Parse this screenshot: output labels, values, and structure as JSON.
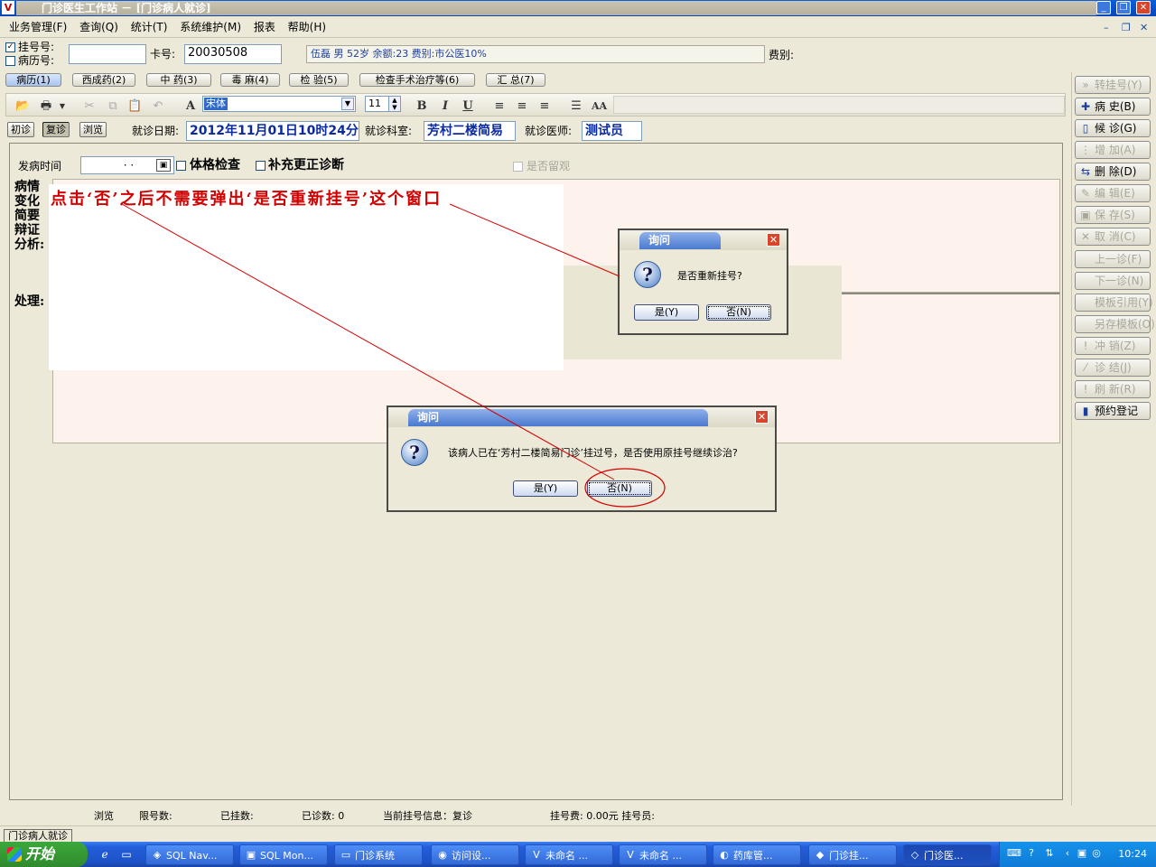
{
  "window": {
    "title": "门诊医生工作站 － [门诊病人就诊]",
    "app_icon": "V"
  },
  "menu": [
    "业务管理(F)",
    "查询(Q)",
    "统计(T)",
    "系统维护(M)",
    "报表",
    "帮助(H)"
  ],
  "header": {
    "reg_no_label": "挂号号:",
    "record_no_label": "病历号:",
    "reg_no_checked": true,
    "record_no_checked": false,
    "reg_no_value": "",
    "card_label": "卡号:",
    "card_value": "20030508",
    "patient_info": "伍磊  男  52岁  余额:23  费别:市公医10%",
    "fee_label": "费别:"
  },
  "tabs": [
    {
      "label": "病历(1)",
      "selected": true
    },
    {
      "label": "西成药(2)",
      "selected": false
    },
    {
      "label": "中 药(3)",
      "selected": false
    },
    {
      "label": "毒 麻(4)",
      "selected": false
    },
    {
      "label": "检 验(5)",
      "selected": false
    },
    {
      "label": "检查手术治疗等(6)",
      "selected": false
    },
    {
      "label": "汇 总(7)",
      "selected": false
    }
  ],
  "toolbar": {
    "font_name": "宋体",
    "font_size": "11",
    "bold": "B",
    "italic": "I",
    "underline": "U",
    "font_glyph": "A",
    "fontsize_glyph": "AA"
  },
  "visit": {
    "first_visit": "初诊",
    "return_visit": "复诊",
    "browse": "浏览",
    "date_label": "就诊日期:",
    "date_value": "2012年11月01日10时24分",
    "dept_label": "就诊科室:",
    "dept_value": "芳村二楼简易",
    "doctor_label": "就诊医师:",
    "doctor_value": "测试员"
  },
  "form": {
    "onset_label": "发病时间",
    "onset_value": "  ·  ·  ",
    "physical_exam": "体格检查",
    "supplement_diag": "补充更正诊断",
    "observation": "是否留观",
    "section_1": [
      "病情",
      "变化",
      "简要",
      "辩证",
      "分析:"
    ],
    "section_2": "处理:"
  },
  "annotation": "点击‘否’之后不需要弹出‘是否重新挂号’这个窗口",
  "right_buttons": [
    {
      "label": "转挂号(Y)",
      "enabled": false,
      "icon": "double-arrow-icon",
      "glyph": "»"
    },
    {
      "label": "病  史(B)",
      "enabled": true,
      "icon": "plus-icon",
      "glyph": "✚"
    },
    {
      "label": "候  诊(G)",
      "enabled": true,
      "icon": "document-icon",
      "glyph": "▯"
    },
    {
      "label": "增  加(A)",
      "enabled": false,
      "icon": "add-icon",
      "glyph": "⋮"
    },
    {
      "label": "删  除(D)",
      "enabled": true,
      "icon": "delete-icon",
      "glyph": "⇆"
    },
    {
      "label": "编  辑(E)",
      "enabled": false,
      "icon": "edit-icon",
      "glyph": "✎"
    },
    {
      "label": "保  存(S)",
      "enabled": false,
      "icon": "save-icon",
      "glyph": "▣"
    },
    {
      "label": "取  消(C)",
      "enabled": false,
      "icon": "cancel-icon",
      "glyph": "✕"
    },
    {
      "label": "上一诊(F)",
      "enabled": false,
      "icon": "",
      "glyph": ""
    },
    {
      "label": "下一诊(N)",
      "enabled": false,
      "icon": "",
      "glyph": ""
    },
    {
      "label": "模板引用(Y)",
      "enabled": false,
      "icon": "",
      "glyph": ""
    },
    {
      "label": "另存模板(O)",
      "enabled": false,
      "icon": "",
      "glyph": ""
    },
    {
      "label": "冲  销(Z)",
      "enabled": false,
      "icon": "exclamation-icon",
      "glyph": "!"
    },
    {
      "label": "诊  结(J)",
      "enabled": false,
      "icon": "check-icon",
      "glyph": "⁄"
    },
    {
      "label": "刷  新(R)",
      "enabled": false,
      "icon": "exclamation-icon",
      "glyph": "!"
    },
    {
      "label": "预约登记",
      "enabled": true,
      "icon": "book-icon",
      "glyph": "▮"
    }
  ],
  "dialog_small": {
    "title": "询问",
    "message": "是否重新挂号?",
    "yes": "是(Y)",
    "no": "否(N)",
    "icon": "question-icon"
  },
  "dialog_large": {
    "title": "询问",
    "message": "该病人已在‘芳村二楼简易门诊’挂过号，是否使用原挂号继续诊治?",
    "yes": "是(Y)",
    "no": "否(N)",
    "icon": "question-icon"
  },
  "status": {
    "browse": "浏览",
    "limit": "限号数:",
    "registered": "已挂数:",
    "consulted": "已诊数: 0",
    "current_info": "当前挂号信息：复诊",
    "fee": "挂号费: 0.00元 挂号员:"
  },
  "mdi_tab": "门诊病人就诊",
  "taskbar": {
    "start": "开始",
    "tasks": [
      {
        "label": "SQL Nav...",
        "icon": "sql-navigator-icon",
        "glyph": "◈",
        "active": false
      },
      {
        "label": "SQL Mon...",
        "icon": "sql-monitor-icon",
        "glyph": "▣",
        "active": false
      },
      {
        "label": "门诊系统",
        "icon": "folder-icon",
        "glyph": "▭",
        "active": false
      },
      {
        "label": "访问设...",
        "icon": "access-icon",
        "glyph": "◉",
        "active": false
      },
      {
        "label": "未命名 ...",
        "icon": "app-icon",
        "glyph": "V",
        "active": false
      },
      {
        "label": "未命名 ...",
        "icon": "app-icon",
        "glyph": "V",
        "active": false
      },
      {
        "label": "药库管...",
        "icon": "pharmacy-icon",
        "glyph": "◐",
        "active": false
      },
      {
        "label": "门诊挂...",
        "icon": "registration-icon",
        "glyph": "◆",
        "active": false
      },
      {
        "label": "门诊医...",
        "icon": "clinic-icon",
        "glyph": "◇",
        "active": true
      }
    ],
    "clock": "10:24"
  },
  "colors": {
    "annotation_red": "#d20000",
    "taskbar_blue": "#245edb",
    "start_green": "#3ca83a",
    "link_blue": "#0a2a9e"
  }
}
